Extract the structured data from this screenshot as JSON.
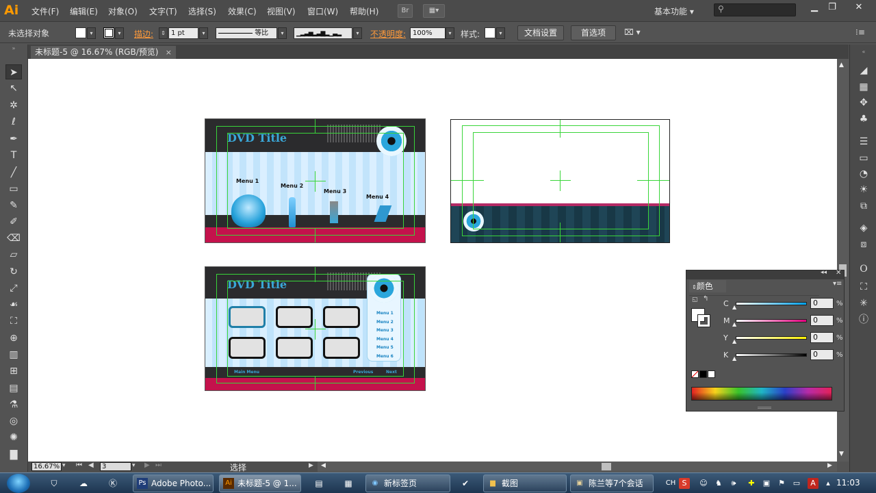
{
  "app": {
    "logo": "Ai",
    "workspace": "基本功能",
    "bridge": "Br"
  },
  "menu": [
    "文件(F)",
    "编辑(E)",
    "对象(O)",
    "文字(T)",
    "选择(S)",
    "效果(C)",
    "视图(V)",
    "窗口(W)",
    "帮助(H)"
  ],
  "control": {
    "selection": "未选择对象",
    "stroke_label": "描边:",
    "stroke_width": "1 pt",
    "stroke_style": "等比",
    "opacity_label": "不透明度:",
    "opacity_value": "100%",
    "style_label": "样式:",
    "doc_setup": "文档设置",
    "prefs": "首选项"
  },
  "document_tab": {
    "title": "未标题-5 @ 16.67% (RGB/预览)",
    "close": "×"
  },
  "artboards": {
    "a1": {
      "title": "DVD Title",
      "menus": [
        "Menu 1",
        "Menu 2",
        "Menu 3",
        "Menu 4"
      ]
    },
    "a3": {
      "title": "DVD Title",
      "menus": [
        "Menu 1",
        "Menu 2",
        "Menu 3",
        "Menu 4",
        "Menu 5",
        "Menu 6"
      ],
      "footer_left": "Main Menu",
      "footer_prev": "Previous",
      "footer_next": "Next"
    }
  },
  "color_panel": {
    "title": "颜色",
    "channels": [
      {
        "label": "C",
        "value": "0",
        "gradient": "linear-gradient(to right,#fff,#00a0e9)"
      },
      {
        "label": "M",
        "value": "0",
        "gradient": "linear-gradient(to right,#fff,#e4007f)"
      },
      {
        "label": "Y",
        "value": "0",
        "gradient": "linear-gradient(to right,#fff,#fff100)"
      },
      {
        "label": "K",
        "value": "0",
        "gradient": "linear-gradient(to right,#fff,#000)"
      }
    ],
    "unit": "%"
  },
  "status": {
    "zoom": "16.67%",
    "artboard": "3",
    "tool": "选择"
  },
  "taskbar": {
    "items": [
      {
        "label": "Adobe Photo...",
        "icon": "Ps",
        "color": "#1f3d78"
      },
      {
        "label": "未标题-5 @ 1...",
        "icon": "Ai",
        "color": "#5a2a00",
        "active": true
      },
      {
        "label": "新标签页",
        "icon": "◉",
        "color": "#2a7ad0"
      },
      {
        "label": "截图",
        "icon": "▆",
        "color": "#d8a63a"
      },
      {
        "label": "陈兰等7个会话",
        "icon": "▣",
        "color": "#8a6a3a"
      }
    ],
    "ime": "CH",
    "clock": "11:03"
  },
  "colors": {
    "accent": "#ff9a00",
    "guide": "#39d539",
    "panel": "#535353",
    "canvas": "#ffffff"
  }
}
